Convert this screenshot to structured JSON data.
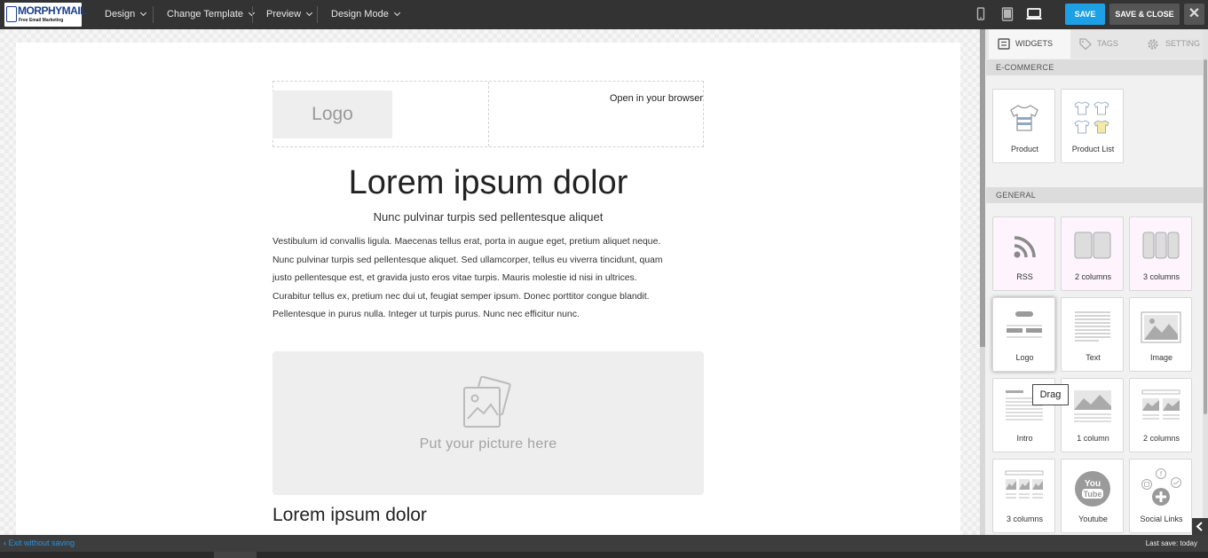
{
  "app": {
    "brand_name": "MORPHYMAIL",
    "brand_tagline": "Free Email Marketing"
  },
  "topbar": {
    "menu": [
      {
        "label": "Design"
      },
      {
        "label": "Change Template"
      },
      {
        "label": "Preview"
      },
      {
        "label": "Design Mode"
      }
    ],
    "devices": [
      "mobile-icon",
      "tablet-icon",
      "desktop-icon"
    ],
    "active_device": "desktop",
    "save_label": "SAVE",
    "save_close_label": "SAVE & CLOSE",
    "close_label": "✕",
    "accent_color": "#1ea0e6"
  },
  "email": {
    "logo_placeholder": "Logo",
    "browser_link": "Open in your browser",
    "headline": "Lorem ipsum dolor",
    "subheadline": "Nunc pulvinar turpis sed pellentesque aliquet",
    "paragraph_lines": [
      "Vestibulum id convallis ligula. Maecenas tellus erat, porta in augue eget, pretium aliquet neque.",
      "Nunc pulvinar turpis sed pellentesque aliquet. Sed ullamcorper, tellus eu viverra tincidunt, quam",
      "justo pellentesque est, et gravida justo eros vitae turpis. Mauris molestie id nisi in ultrices.",
      "Curabitur tellus ex, pretium nec dui ut, feugiat semper ipsum. Donec porttitor congue blandit.",
      "Pellentesque in purus nulla. Integer ut turpis purus. Nunc nec efficitur nunc."
    ],
    "picture_placeholder": "Put your picture here",
    "second_headline": "Lorem ipsum dolor"
  },
  "panel": {
    "tabs": [
      {
        "label": "WIDGETS",
        "icon": "widgets-icon",
        "active": true
      },
      {
        "label": "TAGS",
        "icon": "tag-icon",
        "active": false
      },
      {
        "label": "SETTING",
        "icon": "gear-icon",
        "active": false
      }
    ],
    "sections": [
      {
        "title": "E-COMMERCE",
        "widgets": [
          {
            "label": "Product",
            "icon": "tshirt-icon"
          },
          {
            "label": "Product List",
            "icon": "product-list-icon"
          }
        ]
      },
      {
        "title": "GENERAL",
        "widgets": [
          {
            "label": "RSS",
            "icon": "rss-icon"
          },
          {
            "label": "2 columns",
            "icon": "two-columns-icon"
          },
          {
            "label": "3 columns",
            "icon": "three-columns-icon"
          },
          {
            "label": "Logo",
            "icon": "logo-block-icon"
          },
          {
            "label": "Text",
            "icon": "text-block-icon"
          },
          {
            "label": "Image",
            "icon": "image-block-icon"
          },
          {
            "label": "Intro",
            "icon": "intro-block-icon"
          },
          {
            "label": "1 column",
            "icon": "one-column-image-icon"
          },
          {
            "label": "2 columns",
            "icon": "two-columns-image-icon"
          },
          {
            "label": "3 columns",
            "icon": "three-columns-image-icon"
          },
          {
            "label": "Youtube",
            "icon": "youtube-icon"
          },
          {
            "label": "Social Links",
            "icon": "social-links-icon"
          }
        ]
      }
    ],
    "tooltip": "Drag"
  },
  "status": {
    "exit_label": "Exit without saving",
    "last_save": "Last save: today"
  }
}
